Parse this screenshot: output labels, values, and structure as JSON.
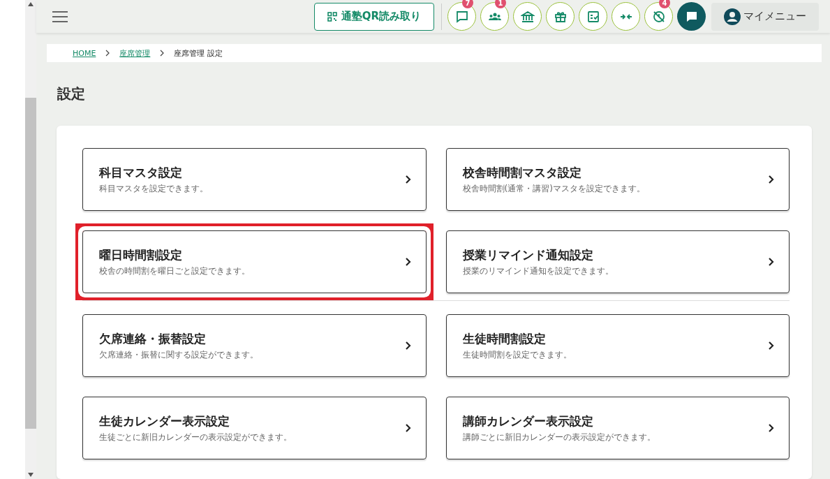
{
  "header": {
    "qr_button": "通塾QR読み取り",
    "icon_buttons": [
      {
        "kind": "chat",
        "badge": "7"
      },
      {
        "kind": "people",
        "badge": "1"
      },
      {
        "kind": "building"
      },
      {
        "kind": "gift"
      },
      {
        "kind": "checklist"
      },
      {
        "kind": "arrows"
      },
      {
        "kind": "clockoff",
        "badge": "4"
      }
    ],
    "my_menu": "マイメニュー"
  },
  "breadcrumb": [
    {
      "label": "HOME",
      "link": true
    },
    {
      "label": "座席管理",
      "link": true
    },
    {
      "label": "座席管理 設定",
      "link": false
    }
  ],
  "page_title": "設定",
  "cards": [
    {
      "title": "科目マスタ設定",
      "description": "科目マスタを設定できます。",
      "highlighted": false
    },
    {
      "title": "校舎時間割マスタ設定",
      "description": "校舎時間割(通常・講習)マスタを設定できます。",
      "highlighted": false
    },
    {
      "title": "曜日時間割設定",
      "description": "校舎の時間割を曜日ごと設定できます。",
      "highlighted": true
    },
    {
      "title": "授業リマインド通知設定",
      "description": "授業のリマインド通知を設定できます。",
      "highlighted": false
    },
    {
      "title": "欠席連絡・振替設定",
      "description": "欠席連絡・振替に関する設定ができます。",
      "highlighted": false
    },
    {
      "title": "生徒時間割設定",
      "description": "生徒時間割を設定できます。",
      "highlighted": false
    },
    {
      "title": "生徒カレンダー表示設定",
      "description": "生徒ごとに新旧カレンダーの表示設定ができます。",
      "highlighted": false
    },
    {
      "title": "講師カレンダー表示設定",
      "description": "講師ごとに新旧カレンダーの表示設定ができます。",
      "highlighted": false
    }
  ]
}
